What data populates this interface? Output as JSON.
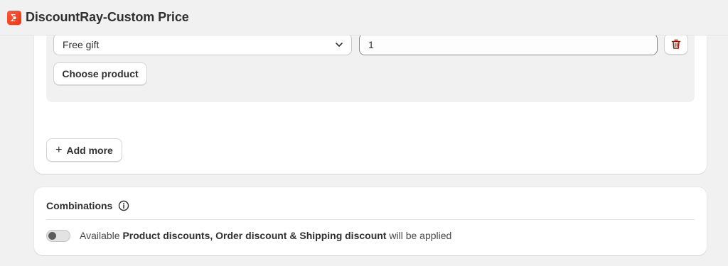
{
  "header": {
    "title": "DiscountRay-Custom Price",
    "logo_icon": "discountray-logo-icon",
    "logo_color": "#e8361c"
  },
  "rule_row": {
    "gift_type_select": {
      "selected": "Free gift",
      "icon": "chevron-down-icon"
    },
    "quantity_input": {
      "value": "1"
    },
    "delete_button": {
      "icon": "trash-icon",
      "color": "#8e1f0b"
    },
    "choose_product_label": "Choose product"
  },
  "add_more": {
    "label": "Add more",
    "icon": "plus-icon"
  },
  "combinations": {
    "title": "Combinations",
    "info_icon": "info-icon",
    "toggle": {
      "state": "off"
    },
    "text_prefix": "Available ",
    "text_bold": "Product discounts, Order discount & Shipping discount",
    "text_suffix": " will be applied"
  }
}
